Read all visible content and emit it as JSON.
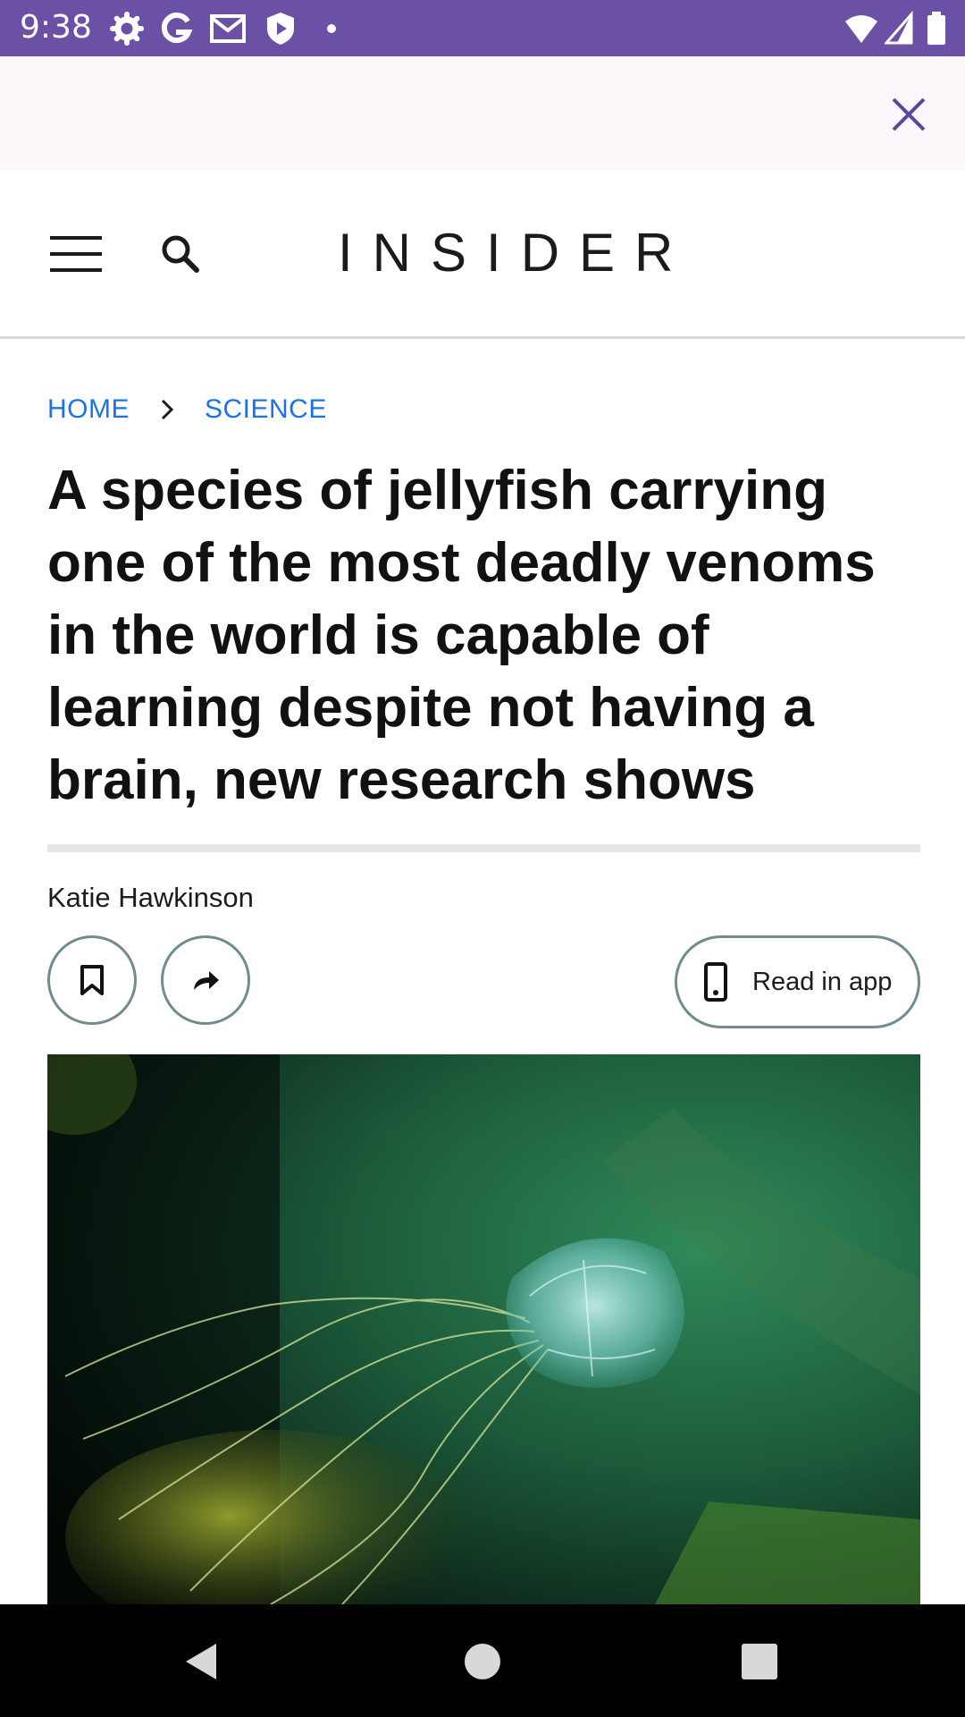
{
  "status_bar": {
    "time": "9:38",
    "icons": [
      "settings-icon",
      "google-icon",
      "gmail-icon",
      "shield-play-icon",
      "dot-icon",
      "wifi-icon",
      "signal-icon",
      "battery-icon"
    ],
    "color": "#6a51a6"
  },
  "ad_strip": {
    "close_icon": "close-icon"
  },
  "header": {
    "logo": "INSIDER",
    "menu_icon": "hamburger-menu-icon",
    "search_icon": "search-icon"
  },
  "breadcrumb": {
    "home": "HOME",
    "section": "SCIENCE",
    "link_color": "#1a73e8"
  },
  "article": {
    "headline": "A species of jellyfish carrying one of the most deadly venoms in the world is capable of learning despite not having a brain, new research shows",
    "author": "Katie Hawkinson",
    "actions": {
      "bookmark_icon": "bookmark-icon",
      "share_icon": "share-arrow-icon",
      "read_in_app": "Read in app"
    },
    "hero_image": "box-jellyfish-photo"
  },
  "nav_bar": {
    "icons": [
      "back-triangle-icon",
      "home-circle-icon",
      "recents-square-icon"
    ]
  }
}
